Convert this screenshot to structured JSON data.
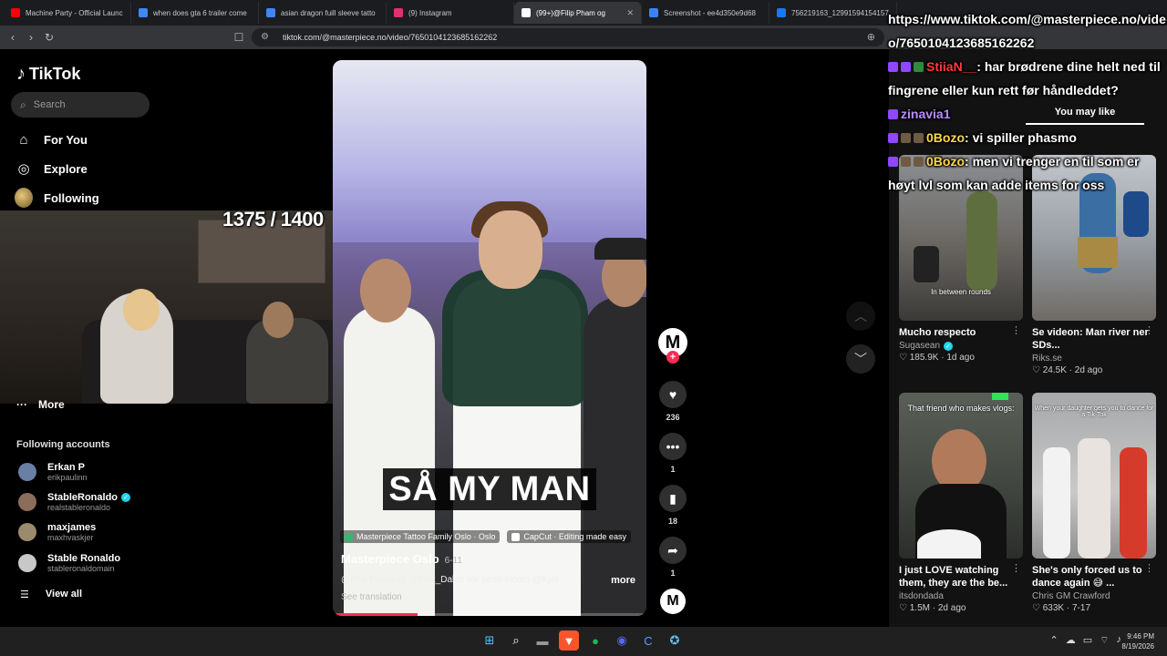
{
  "browser": {
    "tabs": [
      {
        "title": "Machine Party - Official Launc",
        "color": "#ff0000"
      },
      {
        "title": "when does gta 6 trailer come",
        "color": "#4285f4"
      },
      {
        "title": "asian dragon fuill sleeve tatto",
        "color": "#4285f4"
      },
      {
        "title": "(9) Instagram",
        "color": "#e1306c"
      },
      {
        "title": "(99+)@Filip Pham og",
        "color": "#ffffff"
      },
      {
        "title": "Screenshot - ee4d350e9d68",
        "color": "#3b82f6"
      },
      {
        "title": "756219163_12991594154157",
        "color": "#1877f2"
      }
    ],
    "url": "tiktok.com/@masterpiece.no/video/7650104123685162262"
  },
  "sidebar": {
    "logo": "TikTok",
    "search_placeholder": "Search",
    "nav": [
      {
        "label": "For You",
        "icon": "home-icon"
      },
      {
        "label": "Explore",
        "icon": "compass-icon"
      },
      {
        "label": "Following",
        "icon": "following-avatar"
      }
    ],
    "more_label": "More",
    "following_accounts_title": "Following accounts",
    "accounts": [
      {
        "name": "Erkan P",
        "username": "erikpaulinn",
        "verified": false,
        "color": "#6a7fa6"
      },
      {
        "name": "StableRonaldo",
        "username": "realstableronaldo",
        "verified": true,
        "color": "#8a6d5a"
      },
      {
        "name": "maxjames",
        "username": "maxhvaskjer",
        "verified": false,
        "color": "#9c8a6e"
      },
      {
        "name": "Stable Ronaldo",
        "username": "stableronaldomain",
        "verified": false,
        "color": "#c8c8c8"
      }
    ],
    "view_all": "View all"
  },
  "webcam": {
    "counter": "1375 / 1400"
  },
  "video": {
    "caption": "SÅ MY MAN",
    "location_tag": "Masterpiece Tattoo Family Oslo · Oslo",
    "capcut_tag": "CapCut · Editing made easy",
    "author": "Masterpiece Oslo",
    "date": "6-11",
    "description": "@Filip Pham og @Eirik_Dalen tok turen innom @Kyle ...",
    "more_label": "more",
    "see_translation": "See translation",
    "progress": 0.27
  },
  "actions": {
    "creator_initial": "M",
    "likes": "236",
    "comments": "1",
    "saves": "18",
    "shares": "1"
  },
  "right_panel": {
    "tab_label": "You may like",
    "cards": [
      {
        "title": "Mucho respecto",
        "author": "Sugasean",
        "verified": true,
        "stats": "185.9K · 1d ago",
        "overlay": "In between rounds"
      },
      {
        "title": "Se videon: Man river ner SDs...",
        "author": "Riks.se",
        "verified": false,
        "stats": "24.5K · 2d ago",
        "overlay": ""
      },
      {
        "title": "I just LOVE watching them, they are the be...",
        "author": "itsdondada",
        "verified": false,
        "stats": "1.5M · 2d ago",
        "overlay": "That friend who makes vlogs:"
      },
      {
        "title": "She's only forced us to dance again 😅 ...",
        "author": "Chris GM Crawford",
        "verified": false,
        "stats": "633K · 7-17",
        "overlay": "When your daughter gets you to dance for a Tik Tok"
      }
    ]
  },
  "chat": [
    {
      "user": "",
      "message": "https://www.tiktok.com/@masterpiece.no/video/7650104123685162262",
      "user_color": "#ffffff"
    },
    {
      "user": "StiiaN__",
      "message": "har brødrene dine helt ned til fingrene eller kun rett før håndleddet?",
      "user_color": "#ff3b3b"
    },
    {
      "user": "zinavia1",
      "message": "",
      "user_color": "#b98cff"
    },
    {
      "user": "0Bozo",
      "message": "vi spiller phasmo",
      "user_color": "#ffd84a"
    },
    {
      "user": "0Bozo",
      "message": "men vi trenger en til som er høyt lvl som kan adde items for oss",
      "user_color": "#ffd84a"
    }
  ],
  "taskbar": {
    "time": "9:46 PM",
    "date": "8/19/2026"
  }
}
